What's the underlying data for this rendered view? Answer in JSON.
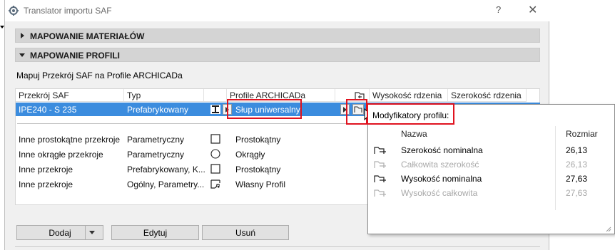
{
  "window": {
    "title": "Translator importu SAF",
    "help": "?",
    "close": "✕"
  },
  "sections": {
    "materials": "MAPOWANIE MATERIAŁÓW",
    "profiles": "MAPOWANIE PROFILI"
  },
  "map_label": "Mapuj Przekrój SAF na Profile ARCHICADa",
  "table": {
    "headers": [
      "Przekrój SAF",
      "Typ",
      "Profile ARCHICADa",
      "Wysokość rdzenia",
      "Szerokość rdzenia"
    ],
    "selected_row": {
      "section": "IPE240 - S 235",
      "type": "Prefabrykowany",
      "profile": "Słup uniwersalny"
    },
    "rows": [
      {
        "section": "Inne prostokątne przekroje",
        "type": "Parametryczny",
        "profile": "Prostokątny"
      },
      {
        "section": "Inne okrągłe przekroje",
        "type": "Parametryczny",
        "profile": "Okrągły"
      },
      {
        "section": "Inne przekroje",
        "type": "Prefabrykowany, K...",
        "profile": "Prostokątny"
      },
      {
        "section": "Inne przekroje",
        "type": "Ogólny, Parametry...",
        "profile": "Własny Profil"
      }
    ]
  },
  "popup": {
    "title": "Modyfikatory profilu:",
    "headers": {
      "name": "Nazwa",
      "size": "Rozmiar"
    },
    "rows": [
      {
        "name": "Szerokość nominalna",
        "value": "26,13",
        "active": true
      },
      {
        "name": "Całkowita szerokość",
        "value": "26,13",
        "active": false
      },
      {
        "name": "Wysokość nominalna",
        "value": "27,63",
        "active": true
      },
      {
        "name": "Wysokość całkowita",
        "value": "27,63",
        "active": false
      }
    ]
  },
  "buttons": {
    "add": "Dodaj",
    "edit": "Edytuj",
    "delete": "Usuń"
  },
  "colors": {
    "selection": "#3b8cde",
    "highlight": "#e0131f"
  }
}
